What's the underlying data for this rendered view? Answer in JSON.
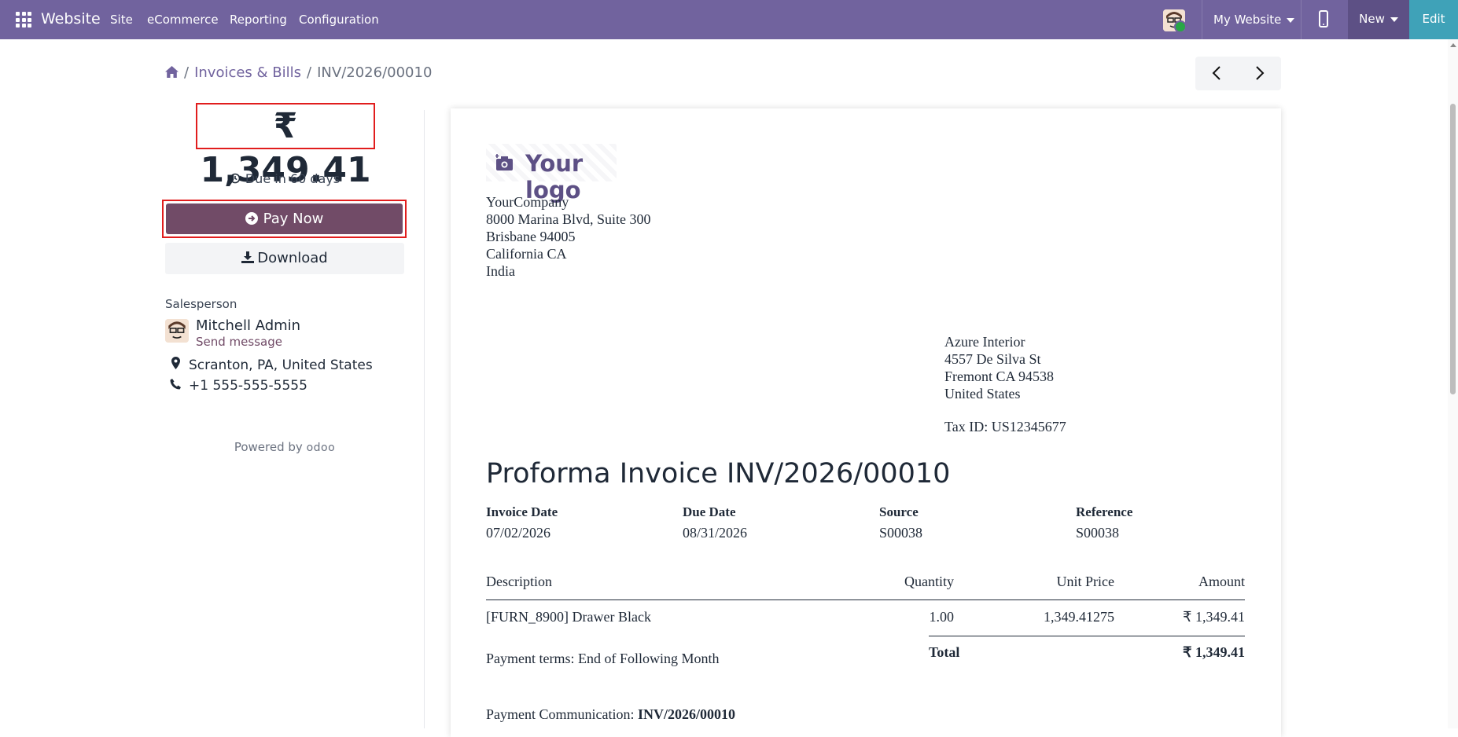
{
  "topbar": {
    "brand": "Website",
    "menu": [
      "Site",
      "eCommerce",
      "Reporting",
      "Configuration"
    ],
    "my_website": "My Website",
    "new_label": "New",
    "edit_label": "Edit",
    "colors": {
      "bar": "#71639e",
      "new": "#5d5085",
      "edit": "#3fa2b8"
    }
  },
  "breadcrumb": {
    "items": [
      "Invoices & Bills",
      "INV/2026/00010"
    ]
  },
  "pager": {
    "prev": "‹",
    "next": "›"
  },
  "sidebar": {
    "amount": "₹ 1,349.41",
    "due": "Due in 60 days",
    "pay_now": "Pay Now",
    "download": "Download",
    "salesperson_label": "Salesperson",
    "salesperson_name": "Mitchell Admin",
    "send_message": "Send message",
    "location": "Scranton, PA, United States",
    "phone": "+1 555-555-5555",
    "powered_by": "Powered by",
    "odoo": "odoo",
    "accent": "#714b67"
  },
  "invoice": {
    "logo_text": "Your logo",
    "company_lines": [
      "YourCompany",
      "8000 Marina Blvd, Suite 300",
      "Brisbane 94005",
      "California CA",
      "India"
    ],
    "customer_lines": [
      "Azure Interior",
      "4557 De Silva St",
      "Fremont CA 94538",
      "United States"
    ],
    "tax_id": "Tax ID: US12345677",
    "title": "Proforma Invoice INV/2026/00010",
    "meta": [
      {
        "label": "Invoice Date",
        "value": "07/02/2026"
      },
      {
        "label": "Due Date",
        "value": "08/31/2026"
      },
      {
        "label": "Source",
        "value": "S00038"
      },
      {
        "label": "Reference",
        "value": "S00038"
      }
    ],
    "columns": [
      "Description",
      "Quantity",
      "Unit Price",
      "Amount"
    ],
    "rows": [
      {
        "description": "[FURN_8900] Drawer Black",
        "quantity": "1.00",
        "unit_price": "1,349.41275",
        "amount": "₹ 1,349.41"
      }
    ],
    "total_label": "Total",
    "total_value": "₹ 1,349.41",
    "payment_terms": "Payment terms: End of Following Month",
    "payment_communication_label": "Payment Communication:",
    "payment_communication_value": "INV/2026/00010"
  }
}
